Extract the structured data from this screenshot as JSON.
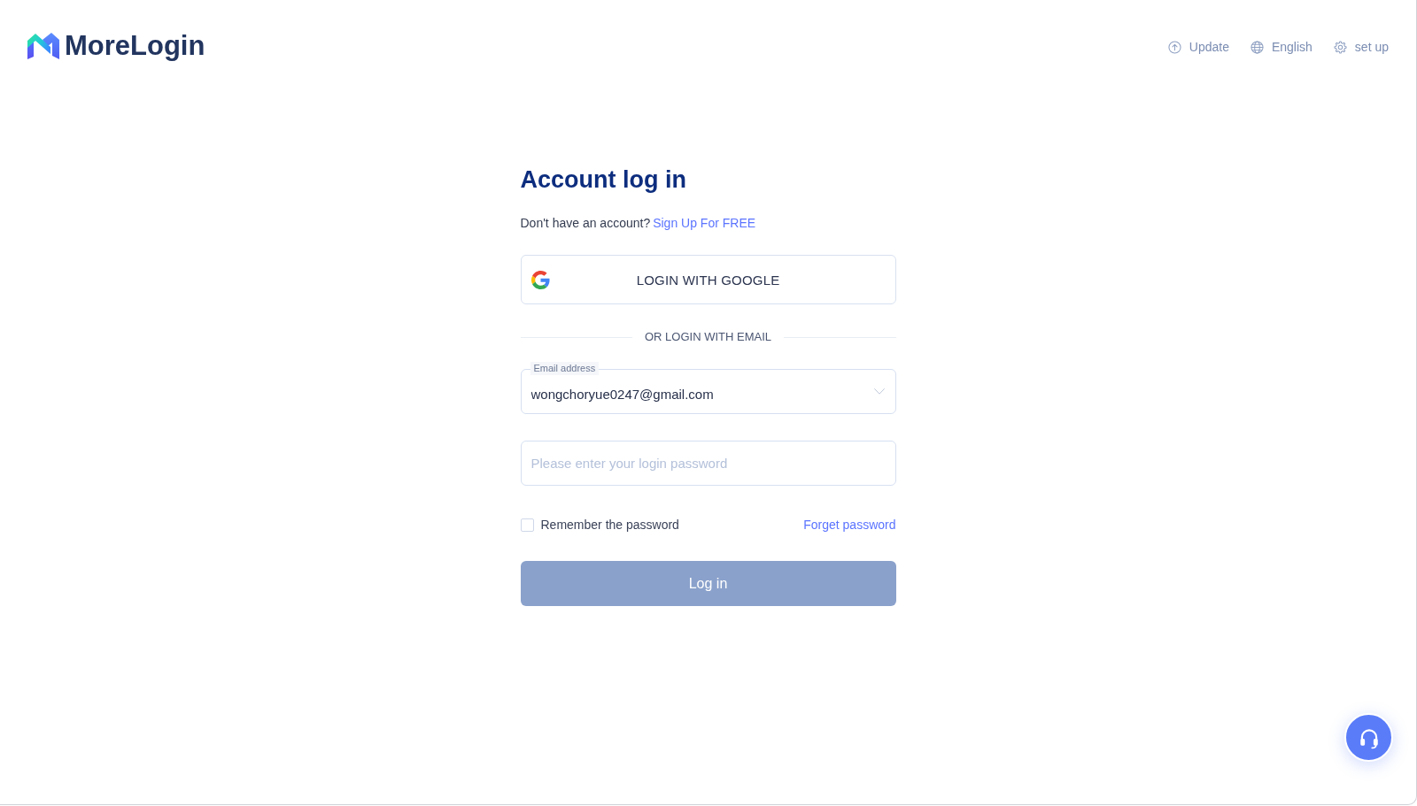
{
  "header": {
    "logo": "MoreLogin",
    "actions": [
      {
        "kind": "update",
        "label": "Update"
      },
      {
        "kind": "language",
        "label": "English"
      },
      {
        "kind": "settings",
        "label": "set up"
      }
    ]
  },
  "login_form": {
    "title": "Account log in",
    "signup_prompt": "Don't have an account?",
    "signup_link": "Sign Up For FREE",
    "google_button": "LOGIN WITH GOOGLE",
    "divider": "OR LOGIN WITH EMAIL",
    "email_field": {
      "label": "Email address",
      "value": "wongchoryue0247@gmail.com"
    },
    "password_field": {
      "placeholder": "Please enter your login password"
    },
    "remember": {
      "label": "Remember the password",
      "checked": false
    },
    "forgot_link": "Forget password",
    "login_button": {
      "label": "Log in",
      "disabled": true
    }
  }
}
